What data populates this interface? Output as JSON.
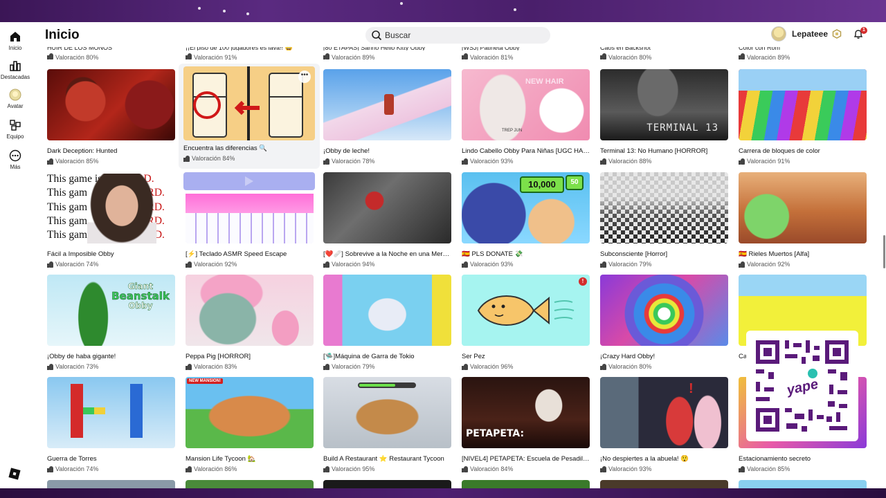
{
  "sidebar": {
    "items": [
      {
        "label": "Inicio"
      },
      {
        "label": "Destacadas"
      },
      {
        "label": "Avatar"
      },
      {
        "label": "Equipo"
      },
      {
        "label": "Más"
      }
    ]
  },
  "header": {
    "title": "Inicio",
    "search_placeholder": "Buscar",
    "username": "Lepateee",
    "notifications_count": "1"
  },
  "partial_row": [
    {
      "title": "HUIR DE LOS MONOS",
      "rating": "Valoración 80%"
    },
    {
      "title": "¡¡El piso de 100 jugadores es lava!! 😄",
      "rating": "Valoración 91%"
    },
    {
      "title": "[80 ETAPAS] Sanrio Hello Kitty Obby",
      "rating": "Valoración 89%"
    },
    {
      "title": "[WSJ] Patineta Obby",
      "rating": "Valoración 81%"
    },
    {
      "title": "Caos en Backshot",
      "rating": "Valoración 80%"
    },
    {
      "title": "Color con Rom",
      "rating": "Valoración 89%"
    }
  ],
  "rows": [
    [
      {
        "title": "Dark Deception: Hunted",
        "rating": "Valoración 85%"
      },
      {
        "title": "Encuentra las diferencias 🔍",
        "rating": "Valoración 84%"
      },
      {
        "title": "¡Obby de leche!",
        "rating": "Valoración 78%"
      },
      {
        "title": "Lindo Cabello Obby Para Niñas [UGC HAIR]",
        "rating": "Valoración 93%"
      },
      {
        "title": "Terminal 13: No Humano [HORROR]",
        "rating": "Valoración 88%"
      },
      {
        "title": "Carrera de bloques de color",
        "rating": "Valoración 91%"
      }
    ],
    [
      {
        "title": "Fácil a Imposible Obby",
        "rating": "Valoración 74%"
      },
      {
        "title": "[⚡] Teclado ASMR Speed Escape",
        "rating": "Valoración 92%"
      },
      {
        "title": "[❤️🩹] Sobrevive a la Noche en una Mercería",
        "rating": "Valoración 94%"
      },
      {
        "title": "🇪🇸 PLS DONATE 💸",
        "rating": "Valoración 93%"
      },
      {
        "title": "Subconsciente [Horror]",
        "rating": "Valoración 79%"
      },
      {
        "title": "🇪🇸 Rieles Muertos [Alfa]",
        "rating": "Valoración 92%"
      }
    ],
    [
      {
        "title": "¡Obby de haba gigante!",
        "rating": "Valoración 73%"
      },
      {
        "title": "Peppa Pig [HORROR]",
        "rating": "Valoración 83%"
      },
      {
        "title": "[🛸]Máquina de Garra de Tokio",
        "rating": "Valoración 79%"
      },
      {
        "title": "Ser Pez",
        "rating": "Valoración 96%"
      },
      {
        "title": "¡Crazy Hard Obby!",
        "rating": "Valoración 80%"
      },
      {
        "title": "Ca",
        "rating": ""
      }
    ],
    [
      {
        "title": "Guerra de Torres",
        "rating": "Valoración 74%"
      },
      {
        "title": "Mansion Life Tycoon 🏡",
        "rating": "Valoración 86%"
      },
      {
        "title": "Build A Restaurant ⭐ Restaurant Tycoon",
        "rating": "Valoración 95%"
      },
      {
        "title": "[NIVEL4] PETAPETA: Escuela de Pesadillas",
        "rating": "Valoración 84%"
      },
      {
        "title": "¡No despiertes a la abuela! 😲",
        "rating": "Valoración 93%"
      },
      {
        "title": "Estacionamiento secreto",
        "rating": "Valoración 85%"
      }
    ]
  ],
  "thumb_text": {
    "terminal": "TERMINAL 13",
    "donate": "10,000",
    "donate_small": "50",
    "giant_top": "Giant",
    "giant_mid": "Beanstalk",
    "giant_bot": "Obby",
    "new_mansion": "NEW MANSION!",
    "petapeta": "PETAPETA:",
    "hair_tag": "TREP JUN",
    "hair_banner": "NEW HAIR"
  },
  "meme_overlay": {
    "line_a": "This game is too ",
    "line_b": "This gam",
    "hard": "HARD."
  },
  "qr": {
    "brand": "yape"
  },
  "colors": {
    "accent": "#335fff",
    "alert": "#d42c2c",
    "frame": "#2a0d3e"
  }
}
